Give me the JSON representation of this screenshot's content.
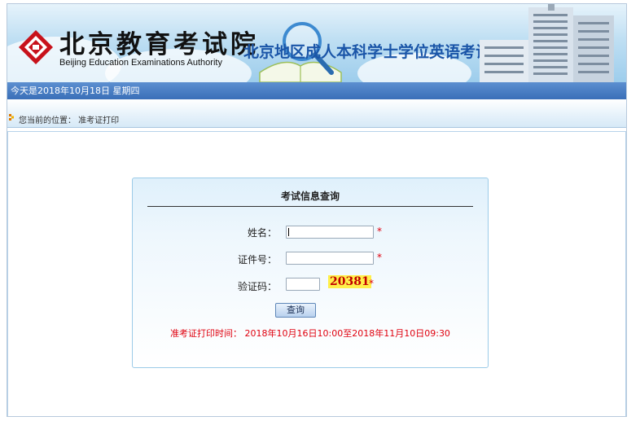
{
  "header": {
    "logo_cn": "北京教育考试院",
    "logo_en": "Beijing Education Examinations Authority",
    "platform_title": "北京地区成人本科学士学位英语考试准考证打印平台"
  },
  "datebar": {
    "text": "今天是2018年10月18日 星期四"
  },
  "breadcrumb": {
    "text": "您当前的位置： 准考证打印"
  },
  "query_panel": {
    "title": "考试信息查询",
    "fields": [
      {
        "label": "姓名：",
        "value": "",
        "required_mark": "*"
      },
      {
        "label": "证件号：",
        "value": "",
        "required_mark": "*"
      },
      {
        "label": "验证码：",
        "value": "",
        "required_mark": "*"
      }
    ],
    "captcha_code": "20381",
    "submit_label": "查询",
    "print_time_note": "准考证打印时间： 2018年10月16日10:00至2018年11月10日09:30"
  },
  "colors": {
    "title_blue": "#1a55a8",
    "datebar_blue": "#3a6fb8",
    "required_red": "#e0000e",
    "captcha_bg": "#ffef4a"
  }
}
